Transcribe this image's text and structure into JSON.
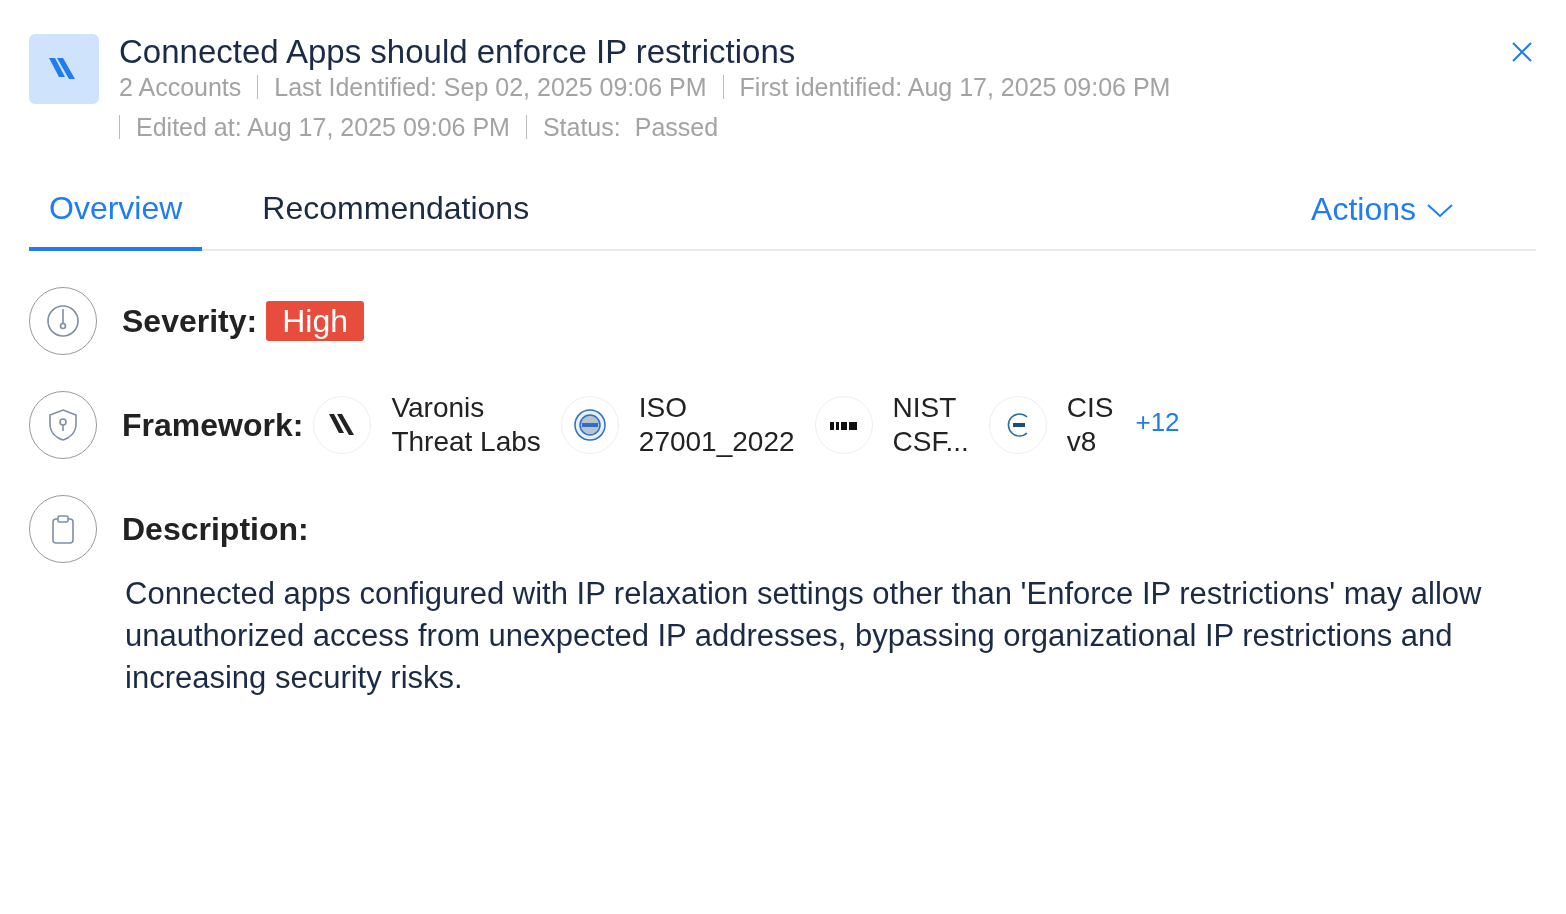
{
  "header": {
    "title": "Connected Apps should enforce IP restrictions",
    "meta": [
      "2 Accounts",
      "Last Identified: Sep 02, 2025 09:06 PM",
      "First identified: Aug 17, 2025 09:06 PM"
    ],
    "meta_second": [
      "Edited at: Aug 17, 2025 09:06 PM"
    ],
    "status": {
      "label": "Status:",
      "value": "Passed"
    }
  },
  "tabs": [
    {
      "label": "Overview",
      "selected": true
    },
    {
      "label": "Recommendations",
      "selected": false
    }
  ],
  "actions": {
    "label": "Actions"
  },
  "severity": {
    "label": "Severity:",
    "value": "High",
    "color": "#e74c3c"
  },
  "framework": {
    "label": "Framework:",
    "items": [
      {
        "kind": "varonis",
        "lines": [
          "Varonis",
          "Threat Labs"
        ]
      },
      {
        "kind": "iso",
        "lines": [
          "ISO",
          "27001_2022"
        ]
      },
      {
        "kind": "nist",
        "lines": [
          "NIST",
          "CSF..."
        ]
      },
      {
        "kind": "cis",
        "lines": [
          "CIS",
          "v8"
        ]
      }
    ],
    "more": "+12"
  },
  "description": {
    "label": "Description:",
    "text": "Connected apps configured with IP relaxation settings other than 'Enforce IP restrictions' may allow unauthorized access from unexpected IP addresses, bypassing organizational IP restrictions and increasing security risks."
  }
}
